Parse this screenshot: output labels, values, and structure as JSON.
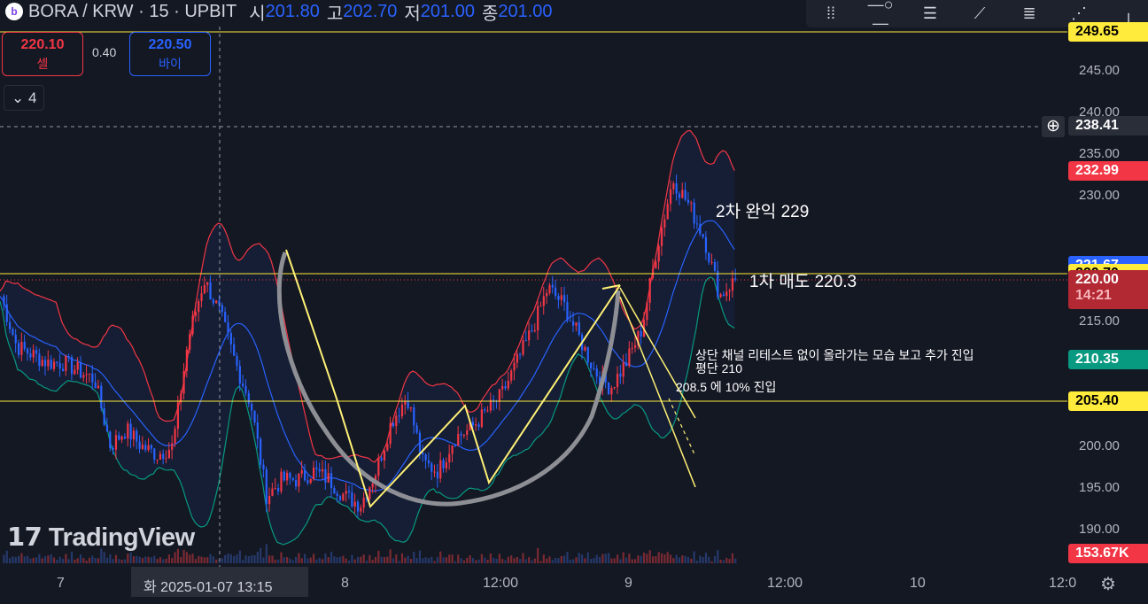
{
  "header": {
    "symbol": "BORA / KRW · 15 · UPBIT",
    "ohlc": [
      {
        "k": "시",
        "v": "201.80"
      },
      {
        "k": "고",
        "v": "202.70"
      },
      {
        "k": "저",
        "v": "201.00"
      },
      {
        "k": "종",
        "v": "201.00"
      }
    ]
  },
  "trade": {
    "sell_price": "220.10",
    "sell_label": "셀",
    "spread": "0.40",
    "buy_price": "220.50",
    "buy_label": "바이",
    "collapse_count": "4"
  },
  "toolbar": {
    "icons": [
      "drag-handle-icon",
      "line-tool-icon",
      "multi-line-icon",
      "trendline-icon",
      "fib-icon",
      "pattern-icon",
      "cursor-icon"
    ]
  },
  "price_axis": {
    "ticks": [
      "245.00",
      "240.00",
      "235.00",
      "230.00",
      "215.00",
      "200.00",
      "195.00",
      "190.00"
    ],
    "labels": [
      {
        "text": "249.65",
        "price": 249.65,
        "bg": "#ffeb3b",
        "fg": "#000"
      },
      {
        "text": "238.41",
        "price": 238.41,
        "bg": "#2a2e39",
        "fg": "#fff"
      },
      {
        "text": "232.99",
        "price": 232.99,
        "bg": "#f23645",
        "fg": "#fff"
      },
      {
        "text": "221.67",
        "price": 221.67,
        "bg": "#2962ff",
        "fg": "#fff"
      },
      {
        "text": "220.70",
        "price": 220.7,
        "bg": "#ffeb3b",
        "fg": "#000"
      },
      {
        "text": "210.35",
        "price": 210.35,
        "bg": "#089981",
        "fg": "#fff"
      },
      {
        "text": "205.40",
        "price": 205.4,
        "bg": "#ffeb3b",
        "fg": "#000"
      }
    ],
    "last": {
      "price": "220.00",
      "countdown": "14:21"
    },
    "volume": "153.67K"
  },
  "time_axis": {
    "ticks": [
      {
        "t": "7",
        "x": 70
      },
      {
        "t": "8",
        "x": 391
      },
      {
        "t": "12:00",
        "x": 551
      },
      {
        "t": "9",
        "x": 711
      },
      {
        "t": "12:00",
        "x": 872
      },
      {
        "t": "10",
        "x": 1033
      },
      {
        "t": "12:0",
        "x": 1190
      }
    ],
    "crosshair_label": "화 2025-01-07   13:15"
  },
  "annotations": {
    "take_profit_2": "2차 완익 229",
    "sell_1": "1차 매도 220.3",
    "note_line1": "상단 채널 리테스트 없이 올라가는 모습 보고 추가 진입",
    "note_line2": "평단 210",
    "note_line3": "208.5 에 10% 진입"
  },
  "brand": "TradingView",
  "chart_data": {
    "type": "candlestick",
    "horizontal_lines": [
      249.65,
      220.7,
      205.4
    ],
    "crosshair_price": 238.41,
    "close_keypoints": [
      218,
      212,
      211,
      210,
      210,
      209,
      208,
      200,
      202,
      200,
      199,
      200,
      213,
      220,
      216,
      210,
      205,
      194,
      196,
      196,
      197,
      196,
      194,
      193,
      197,
      203,
      206,
      198,
      197,
      201,
      202,
      204,
      206,
      210,
      214,
      219,
      217,
      213,
      209,
      207,
      210,
      214,
      224,
      232,
      229,
      225,
      218,
      220
    ],
    "ylim": [
      188,
      250
    ]
  },
  "colors": {
    "up": "#f23645",
    "down": "#2962ff",
    "bb_upper": "#f23645",
    "bb_mid": "#2962ff",
    "bb_lower": "#089981",
    "drawing": "#fff176"
  }
}
